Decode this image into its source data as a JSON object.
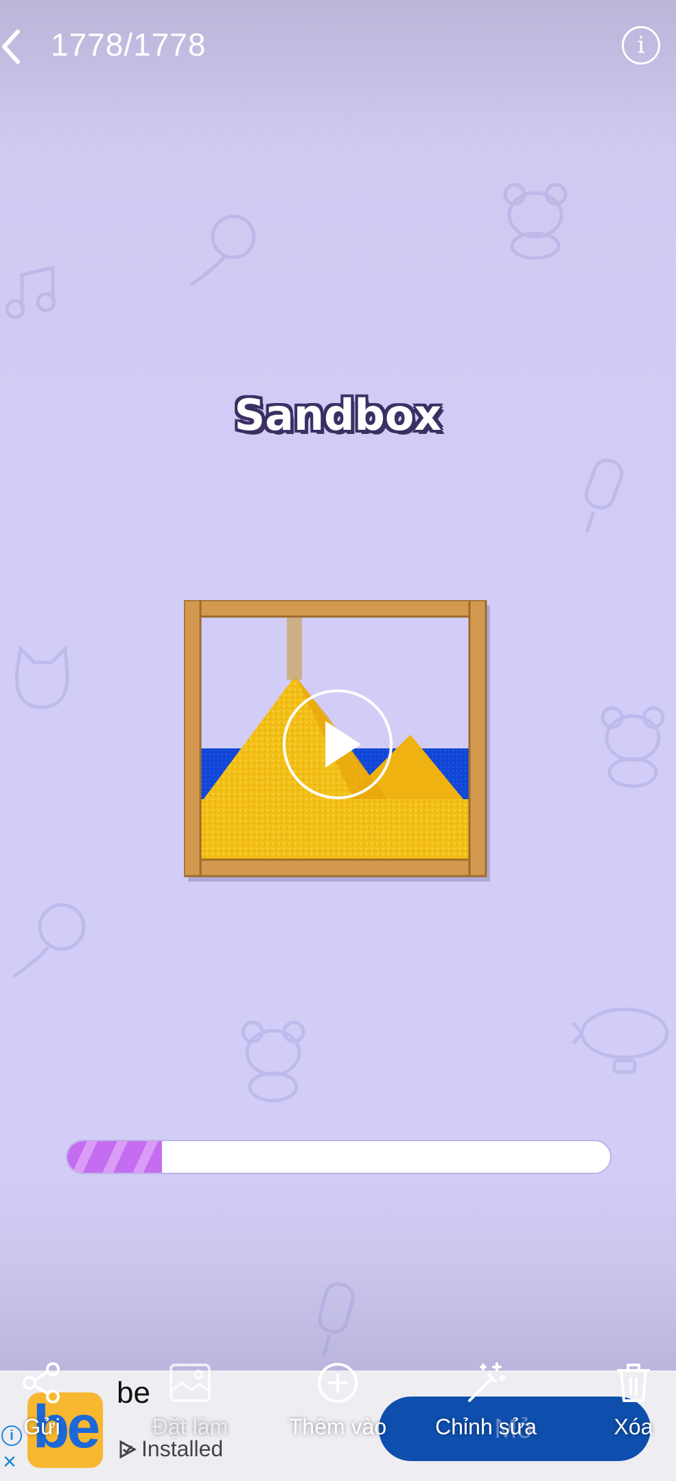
{
  "header": {
    "counter": "1778/1778"
  },
  "game": {
    "title": "Sandbox",
    "progress_fraction": 0.175
  },
  "ad": {
    "app_name": "be",
    "logo_text": "be",
    "status": "Installed",
    "open_label": "Mở",
    "info_glyph": "i",
    "close_glyph": "×"
  },
  "actions": [
    {
      "label": "Gửi",
      "icon": "share-icon"
    },
    {
      "label": "Đặt làm",
      "icon": "image-frame-icon"
    },
    {
      "label": "Thêm vào",
      "icon": "add-circle-icon"
    },
    {
      "label": "Chỉnh sửa",
      "icon": "magic-wand-icon"
    },
    {
      "label": "Xóa",
      "icon": "trash-icon"
    }
  ],
  "colors": {
    "background": "#d2cdf7",
    "progress": "#c46df0",
    "ad_button": "#0e4fae",
    "ad_logo": "#f7b731"
  }
}
